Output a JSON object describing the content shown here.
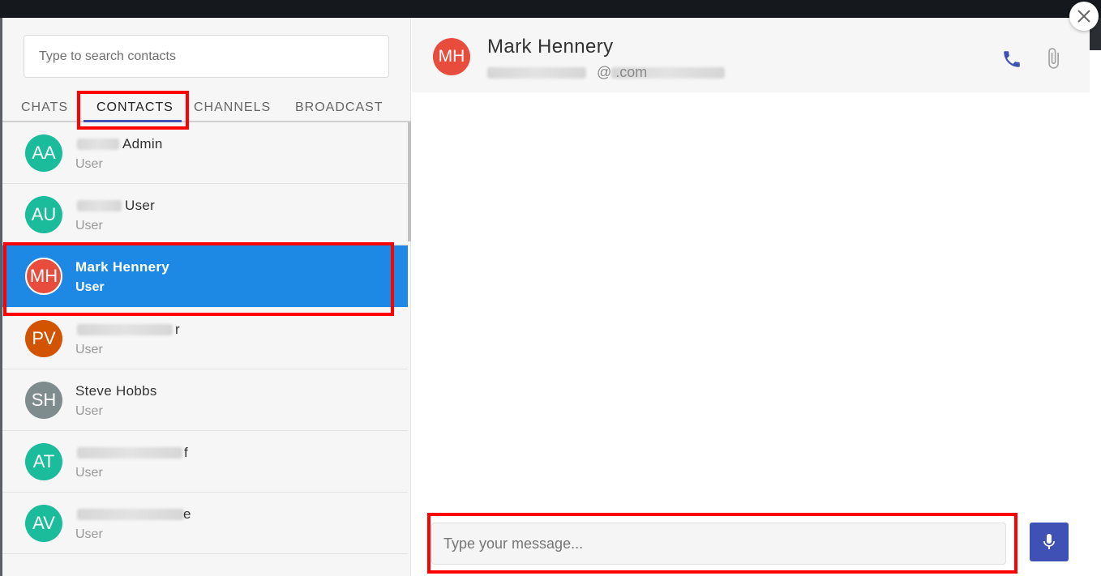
{
  "search": {
    "placeholder": "Type to search contacts"
  },
  "tabs": [
    {
      "label": "CHATS"
    },
    {
      "label": "CONTACTS"
    },
    {
      "label": "CHANNELS"
    },
    {
      "label": "BROADCAST"
    }
  ],
  "active_tab": "CONTACTS",
  "contacts": [
    {
      "initials": "AA",
      "name": "Admin",
      "role": "User",
      "color": "#1abc9c"
    },
    {
      "initials": "AU",
      "name": "User",
      "role": "User",
      "color": "#1abc9c"
    },
    {
      "initials": "MH",
      "name": "Mark Hennery",
      "role": "User",
      "color": "#e74c3c"
    },
    {
      "initials": "PV",
      "name": "r",
      "role": "User",
      "color": "#d35400"
    },
    {
      "initials": "SH",
      "name": "Steve Hobbs",
      "role": "User",
      "color": "#7f8c8d"
    },
    {
      "initials": "AT",
      "name": "f",
      "role": "User",
      "color": "#1abc9c"
    },
    {
      "initials": "AV",
      "name": "e",
      "role": "User",
      "color": "#1abc9c"
    }
  ],
  "chat": {
    "initials": "MH",
    "name": "Mark Hennery",
    "email_visible": "@                .com",
    "avatar_color": "#e74c3c"
  },
  "composer": {
    "placeholder": "Type your message..."
  },
  "colors": {
    "accent": "#3f51b5",
    "selected": "#1e88e5",
    "highlight": "#ff0000"
  },
  "icons": {
    "call": "phone-icon",
    "attach": "paperclip-icon",
    "mic": "microphone-icon",
    "close": "close-icon"
  }
}
